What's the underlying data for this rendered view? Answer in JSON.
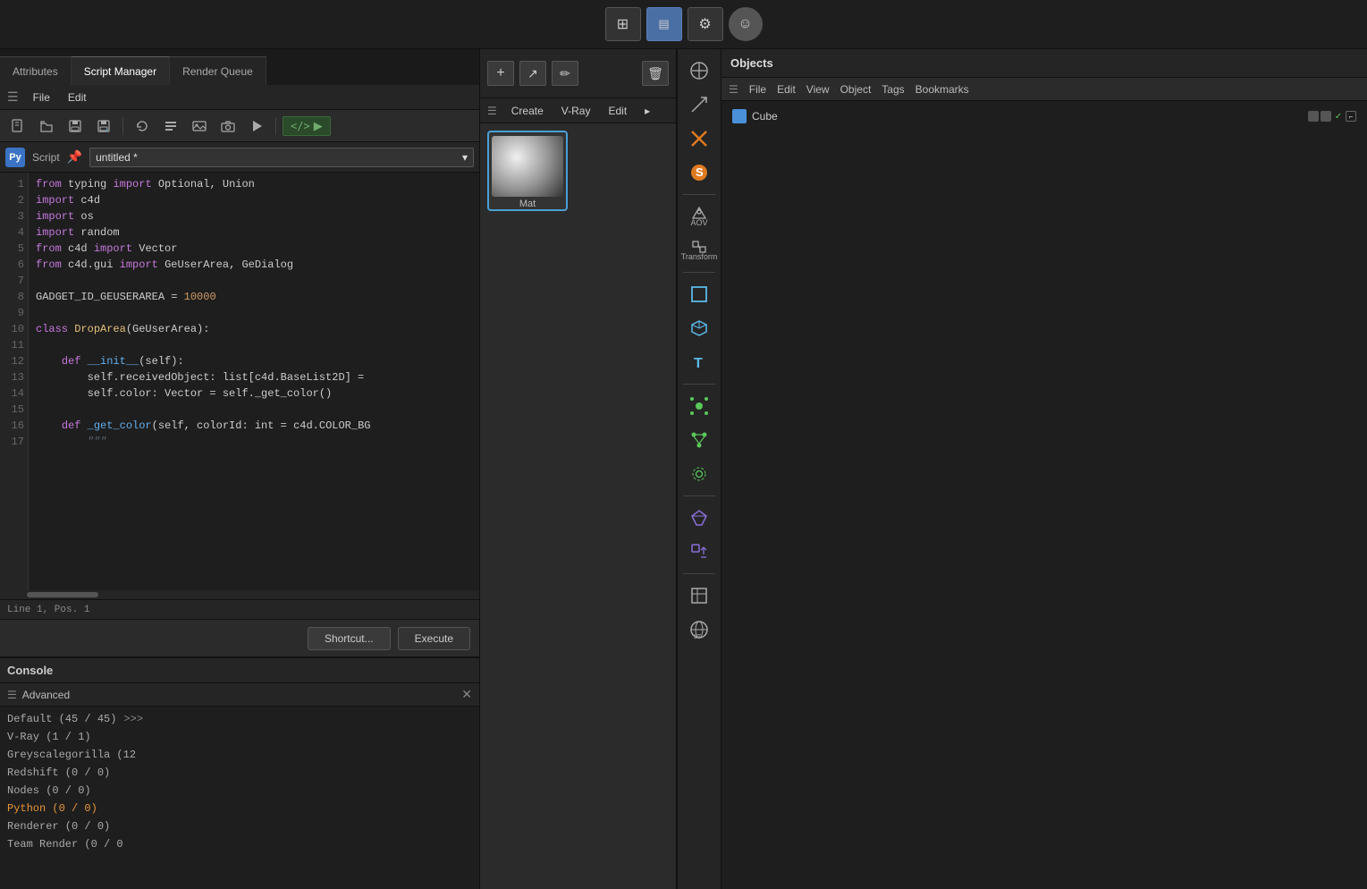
{
  "topToolbar": {
    "buttons": [
      {
        "name": "layout-btn-1",
        "icon": "⊞",
        "active": false
      },
      {
        "name": "layout-btn-2",
        "icon": "▤",
        "active": true
      },
      {
        "name": "layout-btn-3",
        "icon": "⚙",
        "active": false
      },
      {
        "name": "layout-btn-face",
        "icon": "☺",
        "active": false
      }
    ]
  },
  "tabs": [
    {
      "label": "Attributes",
      "active": false
    },
    {
      "label": "Script Manager",
      "active": true
    },
    {
      "label": "Render Queue",
      "active": false
    }
  ],
  "menuBar": {
    "icon": "☰",
    "items": [
      "File",
      "Edit"
    ]
  },
  "scriptMenuBar": {
    "icon": "☰",
    "items": [
      "Script",
      "Edit"
    ]
  },
  "fileToolbar": {
    "buttons": [
      {
        "name": "new-btn",
        "icon": "📄"
      },
      {
        "name": "open-btn",
        "icon": "📁"
      },
      {
        "name": "save-btn",
        "icon": "💾"
      },
      {
        "name": "saveas-btn",
        "icon": "💾"
      },
      {
        "name": "revert-btn",
        "icon": "↩"
      },
      {
        "name": "script-btn",
        "icon": "📋"
      },
      {
        "name": "image-btn",
        "icon": "🖼"
      },
      {
        "name": "cam-btn",
        "icon": "📷"
      },
      {
        "name": "play-btn",
        "icon": "▶"
      }
    ],
    "runCode": "</>",
    "runLabel": "▶"
  },
  "scriptTab": {
    "pythonLabel": "Py",
    "scriptLabel": "Script",
    "pinIcon": "📌",
    "filename": "untitled *",
    "dropdownArrow": "▾"
  },
  "codeEditor": {
    "lines": [
      {
        "num": 1,
        "code": "from typing import Optional, Union"
      },
      {
        "num": 2,
        "code": "import c4d"
      },
      {
        "num": 3,
        "code": "import os"
      },
      {
        "num": 4,
        "code": "import random"
      },
      {
        "num": 5,
        "code": "from c4d import Vector"
      },
      {
        "num": 6,
        "code": "from c4d.gui import GeUserArea, GeDialog"
      },
      {
        "num": 7,
        "code": ""
      },
      {
        "num": 8,
        "code": "GADGET_ID_GEUSERAREA = 10000"
      },
      {
        "num": 9,
        "code": ""
      },
      {
        "num": 10,
        "code": "class DropArea(GeUserArea):"
      },
      {
        "num": 11,
        "code": ""
      },
      {
        "num": 12,
        "code": "    def __init__(self):"
      },
      {
        "num": 13,
        "code": "        self.receivedObject: list[c4d.BaseList2D] ="
      },
      {
        "num": 14,
        "code": "        self.color: Vector = self._get_color()"
      },
      {
        "num": 15,
        "code": ""
      },
      {
        "num": 16,
        "code": "    def _get_color(self, colorId: int = c4d.COLOR_BG"
      },
      {
        "num": 17,
        "code": "        \"\"\""
      }
    ],
    "statusBar": "Line 1, Pos. 1"
  },
  "bottomButtons": {
    "shortcut": "Shortcut...",
    "execute": "Execute"
  },
  "console": {
    "title": "Console",
    "toolbar": {
      "menuIcon": "☰",
      "label": "Advanced",
      "closeIcon": "✕"
    },
    "lines": [
      {
        "text": "Default (45 / 45)",
        "type": "normal"
      },
      {
        "text": ">>>",
        "type": "prompt",
        "inline": true
      },
      {
        "text": "V-Ray (1 / 1)",
        "type": "normal"
      },
      {
        "text": "Greyscalegorilla (12",
        "type": "normal"
      },
      {
        "text": "Redshift (0 / 0)",
        "type": "normal"
      },
      {
        "text": "Nodes (0 / 0)",
        "type": "normal"
      },
      {
        "text": "Python (0 / 0)",
        "type": "orange"
      },
      {
        "text": "Renderer (0 / 0)",
        "type": "normal"
      },
      {
        "text": "Team Render  (0 / 0",
        "type": "normal"
      }
    ]
  },
  "materialPanel": {
    "toolbar": {
      "addIcon": "+",
      "arrowIcon": "↗",
      "editIcon": "✏",
      "deleteIcon": "🗑"
    },
    "menuBar": {
      "icon": "☰",
      "items": [
        "Create",
        "V-Ray",
        "Edit",
        "▸"
      ]
    },
    "materials": [
      {
        "name": "Mat",
        "selected": true
      }
    ]
  },
  "rightSidebar": {
    "icons": [
      {
        "name": "move-icon",
        "icon": "⊕",
        "active": false
      },
      {
        "name": "scale-icon",
        "icon": "↗",
        "active": false
      },
      {
        "name": "rotate-icon",
        "icon": "✖",
        "active": false
      },
      {
        "name": "select-icon",
        "icon": "S",
        "active": false
      },
      {
        "name": "aov-icon",
        "icon": "⚙",
        "active": false,
        "label": "AOV"
      },
      {
        "name": "transform-icon",
        "icon": "⚙",
        "active": false,
        "label": "Transform"
      },
      {
        "name": "rect-icon",
        "icon": "□",
        "active": false
      },
      {
        "name": "cube3d-icon",
        "icon": "◈",
        "active": false
      },
      {
        "name": "text-icon",
        "icon": "T",
        "active": false
      },
      {
        "name": "select2-icon",
        "icon": "⊙",
        "active": false
      },
      {
        "name": "node-icon",
        "icon": "❖",
        "active": false
      },
      {
        "name": "gear-icon",
        "icon": "⚙",
        "active": false
      },
      {
        "name": "gem-icon",
        "icon": "◇",
        "active": false
      },
      {
        "name": "upload-icon",
        "icon": "⬆",
        "active": false
      },
      {
        "name": "box-icon",
        "icon": "⬜",
        "active": false
      },
      {
        "name": "globe-icon",
        "icon": "🌐",
        "active": false
      }
    ]
  },
  "objectsPanel": {
    "title": "Objects",
    "menuIcon": "☰",
    "menuItems": [
      "File",
      "Edit",
      "View",
      "Object",
      "Tags",
      "Bookmarks"
    ],
    "items": [
      {
        "name": "Cube",
        "icon": "cube",
        "statusIcons": [
          "grey",
          "green",
          "outline"
        ]
      }
    ]
  }
}
